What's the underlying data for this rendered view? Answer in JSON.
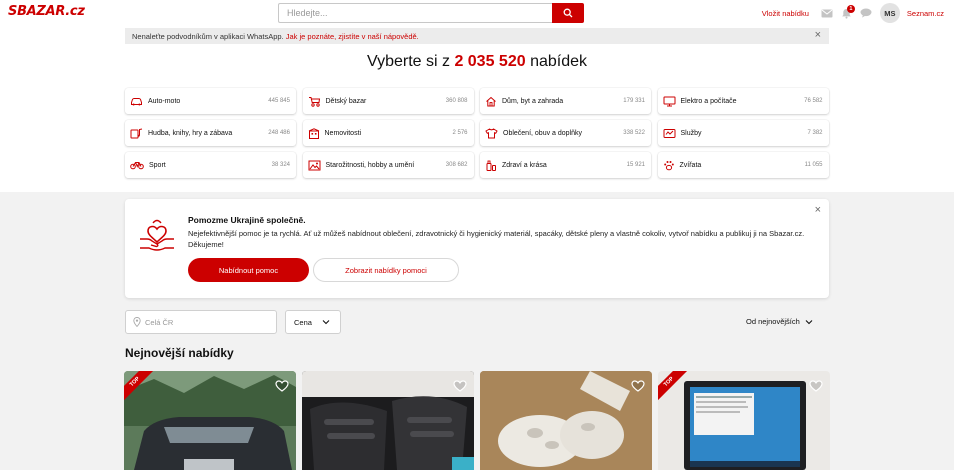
{
  "header": {
    "logo": "SBAZAR.cz",
    "search_placeholder": "Hledejte...",
    "post_ad": "Vložit nabídku",
    "notification_count": "1",
    "avatar_initials": "MS",
    "seznam_link": "Seznam.cz"
  },
  "notice": {
    "text": "Nenaleťte podvodníkům v aplikaci WhatsApp.",
    "link": "Jak je poznáte, zjistíte v naší nápovědě."
  },
  "headline": {
    "prefix": "Vyberte si z",
    "count": "2 035 520",
    "suffix": "nabídek"
  },
  "categories": [
    {
      "label": "Auto-moto",
      "count": "445 845",
      "icon": "car-icon"
    },
    {
      "label": "Dětský bazar",
      "count": "360 808",
      "icon": "stroller-icon"
    },
    {
      "label": "Dům, byt a zahrada",
      "count": "179 331",
      "icon": "house-icon"
    },
    {
      "label": "Elektro a počítače",
      "count": "76 582",
      "icon": "monitor-icon"
    },
    {
      "label": "Hudba, knihy, hry a zábava",
      "count": "248 486",
      "icon": "music-book-icon"
    },
    {
      "label": "Nemovitosti",
      "count": "2 576",
      "icon": "building-icon"
    },
    {
      "label": "Oblečení, obuv a doplňky",
      "count": "338 522",
      "icon": "tshirt-icon"
    },
    {
      "label": "Služby",
      "count": "7 382",
      "icon": "services-icon"
    },
    {
      "label": "Sport",
      "count": "38 324",
      "icon": "bicycle-icon"
    },
    {
      "label": "Starožitnosti, hobby a umění",
      "count": "308 682",
      "icon": "painting-icon"
    },
    {
      "label": "Zdraví a krása",
      "count": "15 921",
      "icon": "cosmetics-icon"
    },
    {
      "label": "Zvířata",
      "count": "11 055",
      "icon": "paw-icon"
    }
  ],
  "ukraine": {
    "title": "Pomozme Ukrajině společně.",
    "text": "Nejefektivnější pomoc je ta rychlá. Ať už můžeš nabídnout oblečení, zdravotnický či hygienický materiál, spacáky, dětské pleny a vlastně cokoliv, vytvoř nabídku a publikuj ji na Sbazar.cz. Děkujeme!",
    "primary_button": "Nabídnout pomoc",
    "secondary_button": "Zobrazit nabídky pomoci"
  },
  "filters": {
    "location_placeholder": "Celá ČR",
    "price": "Cena",
    "sort": "Od nejnovějších"
  },
  "listings_title": "Nejnovější nabídky",
  "listings": [
    {
      "name": "listing-card-car",
      "top_badge": "TOP"
    },
    {
      "name": "listing-card-sandals"
    },
    {
      "name": "listing-card-slippers"
    },
    {
      "name": "listing-card-laptop",
      "top_badge": "TOP"
    }
  ],
  "colors": {
    "accent": "#cc0000",
    "page_background": "#f2f2f2",
    "notice_background": "#ececec"
  }
}
